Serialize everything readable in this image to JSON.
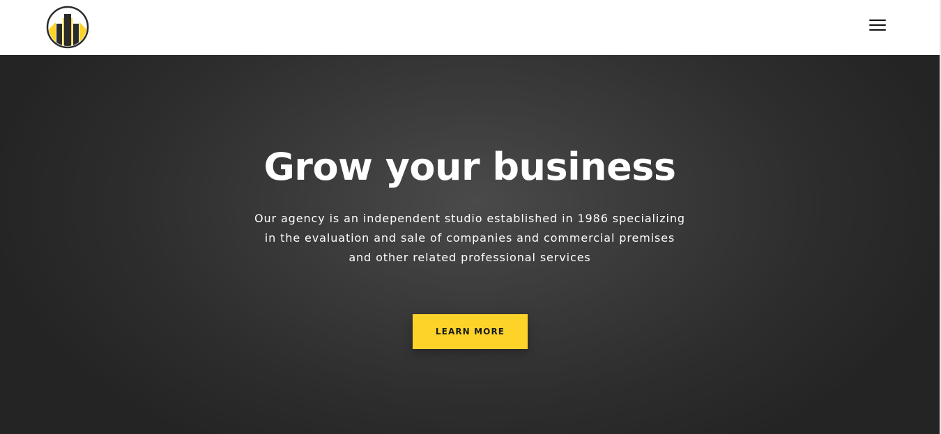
{
  "header": {
    "logo_icon": "building-logo-icon",
    "menu_icon": "hamburger-menu-icon"
  },
  "hero": {
    "title": "Grow your business",
    "description_lines": [
      "Our agency is an independent studio established in 1986 specializing",
      "in the evaluation and sale of companies and commercial premises",
      "and other related professional services"
    ],
    "cta_label": "LEARN MORE"
  },
  "colors": {
    "accent": "#fdd32a",
    "hero_background": "#333333",
    "header_background": "#ffffff",
    "text_light": "#ffffff",
    "logo_dark": "#2b2b2b"
  }
}
